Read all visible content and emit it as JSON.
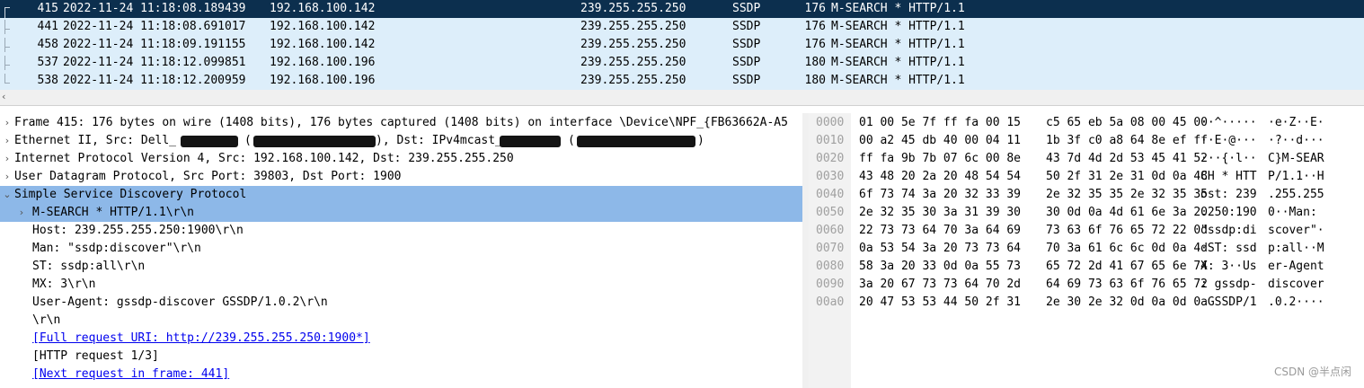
{
  "packets": [
    {
      "no": "415",
      "time": "2022-11-24 11:18:08.189439",
      "src": "192.168.100.142",
      "dst": "239.255.255.250",
      "proto": "SSDP",
      "len": "176",
      "info": "M-SEARCH * HTTP/1.1",
      "selected": true
    },
    {
      "no": "441",
      "time": "2022-11-24 11:18:08.691017",
      "src": "192.168.100.142",
      "dst": "239.255.255.250",
      "proto": "SSDP",
      "len": "176",
      "info": "M-SEARCH * HTTP/1.1"
    },
    {
      "no": "458",
      "time": "2022-11-24 11:18:09.191155",
      "src": "192.168.100.142",
      "dst": "239.255.255.250",
      "proto": "SSDP",
      "len": "176",
      "info": "M-SEARCH * HTTP/1.1"
    },
    {
      "no": "537",
      "time": "2022-11-24 11:18:12.099851",
      "src": "192.168.100.196",
      "dst": "239.255.255.250",
      "proto": "SSDP",
      "len": "180",
      "info": "M-SEARCH * HTTP/1.1"
    },
    {
      "no": "538",
      "time": "2022-11-24 11:18:12.200959",
      "src": "192.168.100.196",
      "dst": "239.255.255.250",
      "proto": "SSDP",
      "len": "180",
      "info": "M-SEARCH * HTTP/1.1"
    }
  ],
  "details": {
    "frame": "Frame 415: 176 bytes on wire (1408 bits), 176 bytes captured (1408 bits) on interface \\Device\\NPF_{FB63662A-A5",
    "eth_prefix": "Ethernet II, Src: Dell_",
    "eth_mid": "(",
    "eth_dst": "), Dst: IPv4mcast_",
    "eth_end": "(",
    "eth_close": ")",
    "ip": "Internet Protocol Version 4, Src: 192.168.100.142, Dst: 239.255.255.250",
    "udp": "User Datagram Protocol, Src Port: 39803, Dst Port: 1900",
    "ssdp": "Simple Service Discovery Protocol",
    "msearch": "M-SEARCH * HTTP/1.1\\r\\n",
    "host": "Host: 239.255.255.250:1900\\r\\n",
    "man": "Man: \"ssdp:discover\"\\r\\n",
    "st": "ST: ssdp:all\\r\\n",
    "mx": "MX: 3\\r\\n",
    "ua": "User-Agent: gssdp-discover GSSDP/1.0.2\\r\\n",
    "crlf": "\\r\\n",
    "full_uri": "[Full request URI: http://239.255.255.250:1900*]",
    "http_req": "[HTTP request 1/3]",
    "next_req": "[Next request in frame: 441]"
  },
  "bytes": [
    {
      "off": "0000",
      "h1": "01 00 5e 7f ff fa 00 15",
      "h2": "c5 65 eb 5a 08 00 45 00",
      "a1": "··^·····",
      "a2": "·e·Z··E·"
    },
    {
      "off": "0010",
      "h1": "00 a2 45 db 40 00 04 11",
      "h2": "1b 3f c0 a8 64 8e ef ff",
      "a1": "··E·@···",
      "a2": "·?··d···"
    },
    {
      "off": "0020",
      "h1": "ff fa 9b 7b 07 6c 00 8e",
      "h2": "43 7d 4d 2d 53 45 41 52",
      "a1": "···{·l··",
      "a2": "C}M-SEAR"
    },
    {
      "off": "0030",
      "h1": "43 48 20 2a 20 48 54 54",
      "h2": "50 2f 31 2e 31 0d 0a 48",
      "a1": "CH * HTT",
      "a2": "P/1.1··H"
    },
    {
      "off": "0040",
      "h1": "6f 73 74 3a 20 32 33 39",
      "h2": "2e 32 35 35 2e 32 35 35",
      "a1": "ost: 239",
      "a2": ".255.255"
    },
    {
      "off": "0050",
      "h1": "2e 32 35 30 3a 31 39 30",
      "h2": "30 0d 0a 4d 61 6e 3a 20",
      "a1": ".250:190",
      "a2": "0··Man: "
    },
    {
      "off": "0060",
      "h1": "22 73 73 64 70 3a 64 69",
      "h2": "73 63 6f 76 65 72 22 0d",
      "a1": "\"ssdp:di",
      "a2": "scover\"·"
    },
    {
      "off": "0070",
      "h1": "0a 53 54 3a 20 73 73 64",
      "h2": "70 3a 61 6c 6c 0d 0a 4d",
      "a1": "·ST: ssd",
      "a2": "p:all··M"
    },
    {
      "off": "0080",
      "h1": "58 3a 20 33 0d 0a 55 73",
      "h2": "65 72 2d 41 67 65 6e 74",
      "a1": "X: 3··Us",
      "a2": "er-Agent"
    },
    {
      "off": "0090",
      "h1": "3a 20 67 73 73 64 70 2d",
      "h2": "64 69 73 63 6f 76 65 72",
      "a1": ": gssdp-",
      "a2": "discover"
    },
    {
      "off": "00a0",
      "h1": "20 47 53 53 44 50 2f 31",
      "h2": "2e 30 2e 32 0d 0a 0d 0a",
      "a1": " GSSDP/1",
      "a2": ".0.2····"
    }
  ],
  "watermark": "CSDN @半点闲",
  "colors": {
    "selected_row": "#0c2f4e",
    "list_bg": "#ddeefa",
    "tree_selected": "#8db8e8",
    "link": "#0000ee"
  }
}
